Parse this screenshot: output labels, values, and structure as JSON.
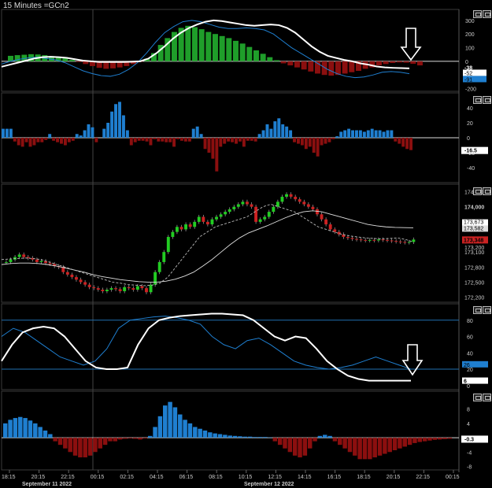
{
  "window": {
    "title": "15 Minutes =GCn2"
  },
  "colors": {
    "background": "#000000",
    "grid": "#2a2a2a",
    "axis_text": "#cccccc",
    "up": "#1f9e2a",
    "down": "#8b0f0f",
    "blue": "#1f7fd0",
    "signal": "#ffffff",
    "candle_up": "#22cc22",
    "candle_down": "#cc2222"
  },
  "chart_data": [
    {
      "type": "bar",
      "panel": "macd",
      "ylim": [
        -220,
        380
      ],
      "yticks": [
        300,
        200,
        100,
        0,
        -200
      ],
      "histogram": [
        40,
        45,
        48,
        52,
        50,
        45,
        38,
        30,
        22,
        10,
        -5,
        -20,
        -35,
        -48,
        -55,
        -52,
        -45,
        -35,
        -20,
        -5,
        20,
        60,
        120,
        170,
        215,
        245,
        260,
        250,
        235,
        215,
        200,
        185,
        170,
        150,
        130,
        105,
        80,
        55,
        30,
        8,
        -15,
        -30,
        -45,
        -60,
        -75,
        -90,
        -100,
        -105,
        -100,
        -90,
        -80,
        -70,
        -55,
        -45,
        -30,
        -20,
        -12,
        -8,
        -10,
        -18,
        -30
      ],
      "signal_line": [
        -40,
        -25,
        -10,
        5,
        20,
        30,
        33,
        30,
        25,
        15,
        5,
        0,
        -5,
        -5,
        -5,
        -5,
        -3,
        0,
        20,
        60,
        110,
        165,
        210,
        245,
        270,
        290,
        300,
        295,
        285,
        275,
        265,
        260,
        265,
        270,
        265,
        245,
        210,
        160,
        110,
        70,
        40,
        25,
        10,
        0,
        -15,
        -25,
        -38,
        -45,
        -48,
        -50,
        -52
      ],
      "macd_line": [
        -20,
        0,
        15,
        25,
        30,
        20,
        10,
        -10,
        -40,
        -70,
        -90,
        -105,
        -110,
        -95,
        -60,
        -10,
        60,
        140,
        210,
        255,
        290,
        300,
        290,
        270,
        250,
        240,
        240,
        245,
        240,
        230,
        200,
        150,
        100,
        60,
        20,
        -20,
        -60,
        -90,
        -110,
        -120,
        -115,
        -100,
        -80,
        -75,
        -80,
        -91
      ],
      "last_values": {
        "line1": "-38",
        "line2": "-52",
        "line3": "-91"
      }
    },
    {
      "type": "bar",
      "panel": "oscillator",
      "ylim": [
        -60,
        60
      ],
      "yticks": [
        40,
        20,
        0,
        -20,
        -40
      ],
      "values": [
        12,
        12,
        12,
        -5,
        -10,
        -12,
        -6,
        -12,
        -10,
        -6,
        -6,
        -3,
        5,
        -4,
        -6,
        -8,
        -10,
        -6,
        -4,
        5,
        3,
        10,
        18,
        14,
        -6,
        0,
        12,
        20,
        35,
        45,
        48,
        30,
        10,
        -10,
        -6,
        -4,
        -4,
        -5,
        -10,
        -2,
        -5,
        -5,
        -6,
        -6,
        -12,
        -2,
        -4,
        -5,
        -5,
        12,
        15,
        5,
        -15,
        -20,
        -28,
        -45,
        -12,
        -8,
        -5,
        -6,
        -8,
        -5,
        -12,
        -4,
        -4,
        -5,
        5,
        10,
        18,
        12,
        22,
        26,
        18,
        15,
        10,
        -6,
        -8,
        -10,
        -15,
        -12,
        -20,
        -25,
        -10,
        -8,
        -6,
        -2,
        2,
        8,
        10,
        12,
        10,
        10,
        10,
        8,
        10,
        12,
        10,
        10,
        8,
        10,
        10,
        -5,
        -8,
        -12,
        -15,
        -16.5
      ],
      "last_value": "-16.5"
    },
    {
      "type": "candlestick",
      "panel": "price",
      "ylim": [
        172100,
        174450
      ],
      "yticks": [
        "174,300",
        "174,000",
        "173,600",
        "173,200",
        "173,100",
        "172,800",
        "172,500",
        "172,200"
      ],
      "close": [
        172900,
        172950,
        173000,
        173050,
        173000,
        172980,
        172950,
        172900,
        172920,
        172880,
        172860,
        172820,
        172800,
        172700,
        172650,
        172600,
        172550,
        172500,
        172450,
        172400,
        172380,
        172350,
        172320,
        172350,
        172380,
        172360,
        172320,
        172400,
        172380,
        172350,
        172420,
        172380,
        172300,
        172450,
        172700,
        172900,
        173100,
        173400,
        173500,
        173600,
        173550,
        173650,
        173600,
        173700,
        173800,
        173700,
        173650,
        173750,
        173800,
        173850,
        173900,
        173950,
        174000,
        174050,
        174100,
        174050,
        174000,
        173700,
        173750,
        173800,
        173900,
        174000,
        174100,
        174200,
        174250,
        174200,
        174150,
        174100,
        174050,
        174000,
        173950,
        173850,
        173750,
        173650,
        173550,
        173500,
        173450,
        173400,
        173380,
        173360,
        173350,
        173340,
        173330,
        173340,
        173330,
        173350,
        173340,
        173330,
        173320,
        173310,
        173300,
        173290,
        173300,
        173348
      ],
      "ma_fast": [
        172950,
        172960,
        172970,
        172980,
        172970,
        172950,
        172900,
        172850,
        172800,
        172750,
        172700,
        172650,
        172600,
        172550,
        172500,
        172480,
        172450,
        172440,
        172430,
        172440,
        172480,
        172600,
        172800,
        173000,
        173200,
        173400,
        173500,
        173600,
        173650,
        173700,
        173750,
        173800,
        173900,
        174000,
        174050,
        174000,
        173950,
        173900,
        173800,
        173700,
        173600,
        173550,
        173500,
        173450,
        173420,
        173400,
        173380,
        173370,
        173360,
        173370,
        173380,
        173350,
        173300
      ],
      "ma_slow": [
        172850,
        172870,
        172880,
        172880,
        172870,
        172850,
        172820,
        172780,
        172740,
        172700,
        172650,
        172610,
        172580,
        172550,
        172530,
        172510,
        172500,
        172500,
        172520,
        172560,
        172620,
        172700,
        172820,
        172950,
        173100,
        173250,
        173380,
        173480,
        173550,
        173620,
        173700,
        173780,
        173850,
        173900,
        173920,
        173900,
        173850,
        173800,
        173750,
        173700,
        173650,
        173620,
        173600,
        173590,
        173585,
        173582
      ],
      "last_values": {
        "top": "173,673",
        "mid": "173,582",
        "close": "173,348"
      }
    },
    {
      "type": "line",
      "panel": "stochastic",
      "ylim": [
        -5,
        100
      ],
      "yticks": [
        80,
        60,
        40,
        20,
        0
      ],
      "levels": [
        80,
        20
      ],
      "k_line": [
        30,
        50,
        65,
        70,
        72,
        70,
        60,
        45,
        30,
        22,
        20,
        20,
        22,
        50,
        70,
        80,
        83,
        85,
        86,
        87,
        88,
        88,
        87,
        86,
        80,
        70,
        60,
        55,
        60,
        58,
        45,
        30,
        20,
        12,
        8,
        6,
        6,
        6,
        6,
        6
      ],
      "d_line": [
        60,
        70,
        65,
        55,
        45,
        35,
        30,
        25,
        30,
        45,
        70,
        80,
        82,
        84,
        85,
        83,
        80,
        75,
        60,
        50,
        45,
        55,
        58,
        50,
        40,
        30,
        25,
        22,
        20,
        22,
        25,
        30,
        35,
        30,
        25,
        20
      ],
      "last_values": {
        "blue": "26",
        "white": "6"
      }
    },
    {
      "type": "bar",
      "panel": "momentum",
      "ylim": [
        -9,
        13
      ],
      "yticks": [
        8,
        4,
        0,
        -4,
        -8
      ],
      "values": [
        4,
        5,
        5.5,
        5.8,
        5.5,
        4.8,
        4,
        3,
        2,
        1,
        -1,
        -2,
        -3,
        -4,
        -5,
        -5.5,
        -5.5,
        -5,
        -4,
        -3,
        -2,
        -1,
        -1,
        -0.5,
        -0.3,
        -0.2,
        -0.3,
        -0.5,
        -0.2,
        0.5,
        3,
        6,
        9,
        10,
        8.5,
        6.5,
        5,
        4,
        3,
        2.5,
        2,
        1.5,
        1.2,
        1,
        0.8,
        0.6,
        0.5,
        0.4,
        0.3,
        0.3,
        0.2,
        0.2,
        0.2,
        0.1,
        -1,
        -2,
        -3,
        -4,
        -5,
        -5.5,
        -5,
        -3,
        -1,
        0.5,
        0.8,
        0.5,
        -1,
        -2,
        -3,
        -4,
        -5,
        -6,
        -6,
        -6,
        -5.5,
        -5,
        -4.5,
        -4,
        -3.5,
        -3,
        -2.5,
        -2,
        -1.5,
        -1.2,
        -1,
        -0.8,
        -0.6,
        -0.5,
        -0.4,
        -0.3
      ],
      "last_value": "-0.3"
    }
  ],
  "time_axis": {
    "ticks": [
      "18:15",
      "20:15",
      "22:15",
      "00:15",
      "02:15",
      "04:15",
      "06:15",
      "08:15",
      "10:15",
      "12:15",
      "14:15",
      "16:15",
      "18:15",
      "20:15",
      "22:15",
      "00:15"
    ],
    "dates": [
      "September 11 2022",
      "September 12 2022"
    ]
  }
}
